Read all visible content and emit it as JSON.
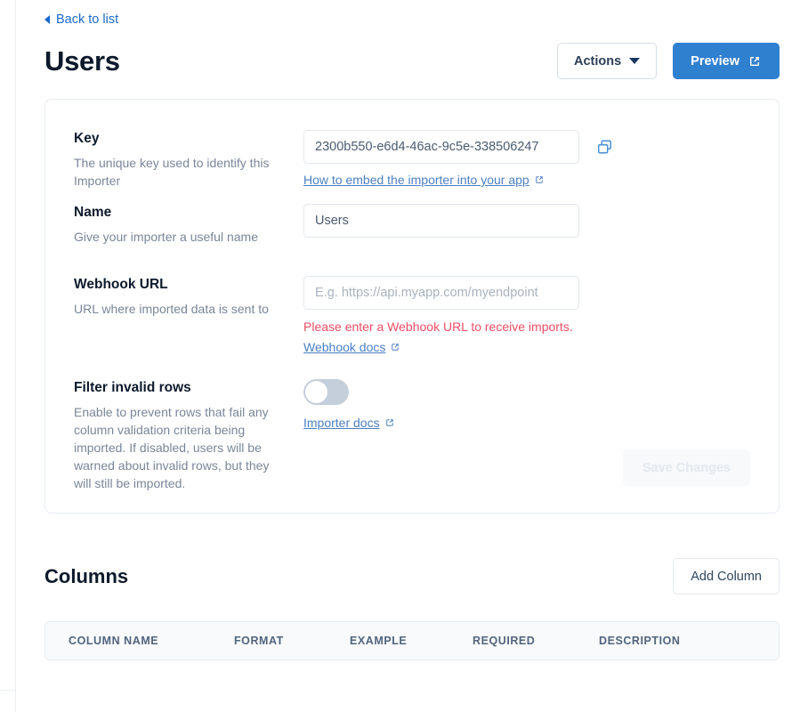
{
  "back": {
    "label": "Back to list",
    "icon": "back-caret-icon"
  },
  "header": {
    "title": "Users",
    "actions_label": "Actions",
    "preview_label": "Preview",
    "dropdown_icon": "chevron-down-icon",
    "external_icon": "external-link-icon",
    "primary_color": "#3080d0"
  },
  "settings": {
    "key": {
      "label": "Key",
      "help": "The unique key used to identify this Importer",
      "value": "2300b550-e6d4-46ac-9c5e-338506247",
      "copy_icon": "copy-icon",
      "link_label": "How to embed the importer into your app"
    },
    "name": {
      "label": "Name",
      "help": "Give your importer a useful name",
      "value": "Users"
    },
    "webhook": {
      "label": "Webhook URL",
      "help": "URL where imported data is sent to",
      "value": "",
      "placeholder": "E.g. https://api.myapp.com/myendpoint",
      "error": "Please enter a Webhook URL to receive imports.",
      "error_color": "#ef4d64",
      "link_label": "Webhook docs"
    },
    "filter": {
      "label": "Filter invalid rows",
      "help": "Enable to prevent rows that fail any column validation criteria being imported. If disabled, users will be warned about invalid rows, but they will still be imported.",
      "enabled": false,
      "link_label": "Importer docs"
    },
    "save_label": "Save Changes",
    "save_disabled": true
  },
  "columns": {
    "title": "Columns",
    "add_label": "Add Column",
    "headers": [
      "COLUMN NAME",
      "FORMAT",
      "EXAMPLE",
      "REQUIRED",
      "DESCRIPTION"
    ],
    "rows": []
  }
}
